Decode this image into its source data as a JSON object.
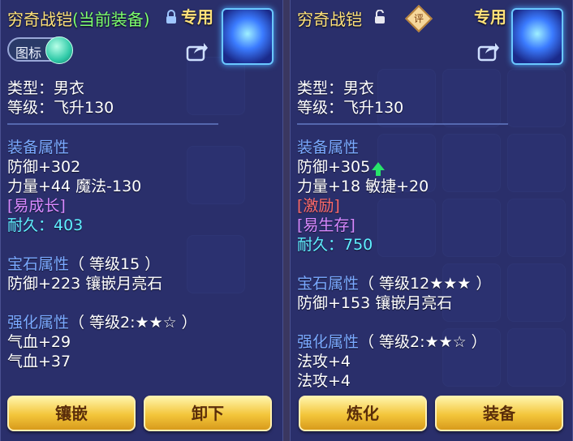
{
  "left": {
    "title": "穷奇战铠",
    "title_current": "(当前装备)",
    "exclusive": "专用",
    "toggle_label": "图标",
    "type": "类型：男衣",
    "level": "等级：飞升130",
    "equip_header": "装备属性",
    "stats": [
      "防御+302",
      "力量+44 魔法-130"
    ],
    "tag": "[易成长]",
    "durability": "耐久：403",
    "gem_header": "宝石属性",
    "gem_level": "（ 等级15 ）",
    "gem_stat": "防御+223 镶嵌月亮石",
    "enhance_header": "强化属性",
    "enhance_level": "（ 等级2:★★☆ ）",
    "enhance_stats": [
      "气血+29",
      "气血+37"
    ],
    "buttons": [
      "镶嵌",
      "卸下"
    ]
  },
  "right": {
    "title": "穷奇战铠",
    "eval_badge": "评",
    "exclusive": "专用",
    "type": "类型：男衣",
    "level": "等级：飞升130",
    "equip_header": "装备属性",
    "stat_defense": "防御+305",
    "stat_line2": "力量+18 敏捷+20",
    "tag_red": "[激励]",
    "tag_purple": "[易生存]",
    "durability": "耐久：750",
    "gem_header": "宝石属性",
    "gem_level": "（ 等级12★★★ ）",
    "gem_stat": "防御+153 镶嵌月亮石",
    "enhance_header": "强化属性",
    "enhance_level": "（ 等级2:★★☆ ）",
    "enhance_stats": [
      "法攻+4",
      "法攻+4"
    ],
    "buttons": [
      "炼化",
      "装备"
    ]
  },
  "colors": {
    "title": "#ffe27a",
    "current_equip": "#7dff6e",
    "section_header": "#7aa9ff",
    "tag_purple": "#d889ff",
    "tag_red": "#ff6b6b",
    "durability": "#5ff0ff",
    "button": "#f3c53a",
    "upgrade_arrow": "#27e36a"
  },
  "icons": [
    "lock-closed-icon",
    "lock-open-icon",
    "share-icon",
    "eval-badge-icon",
    "armor-item-icon",
    "upgrade-arrow-icon"
  ]
}
